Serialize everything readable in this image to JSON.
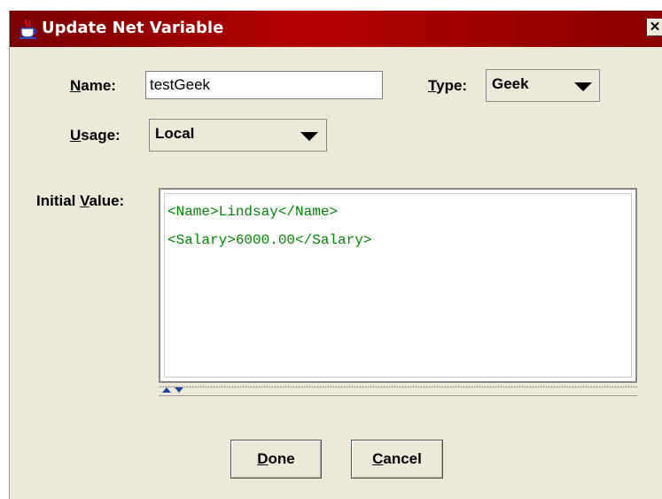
{
  "window": {
    "title": "Update Net Variable",
    "close_glyph": "✕",
    "icon": "java-cup-icon"
  },
  "form": {
    "name": {
      "label_mnemonic": "N",
      "label_rest": "ame:",
      "value": "testGeek"
    },
    "type": {
      "label_mnemonic": "T",
      "label_rest": "ype:",
      "value": "Geek"
    },
    "usage": {
      "label_mnemonic": "U",
      "label_rest": "sage:",
      "value": "Local"
    },
    "initial_value": {
      "label_before": "Initial ",
      "label_mnemonic": "V",
      "label_rest": "alue:",
      "lines": [
        "<Name>Lindsay</Name>",
        "<Salary>6000.00</Salary>"
      ],
      "text_color": "#008800"
    }
  },
  "buttons": {
    "done": {
      "mnemonic": "D",
      "rest": "one"
    },
    "cancel": {
      "mnemonic": "C",
      "rest": "ancel"
    }
  },
  "colors": {
    "titlebar": "#a00000",
    "dialog_bg": "#ece9d8"
  }
}
